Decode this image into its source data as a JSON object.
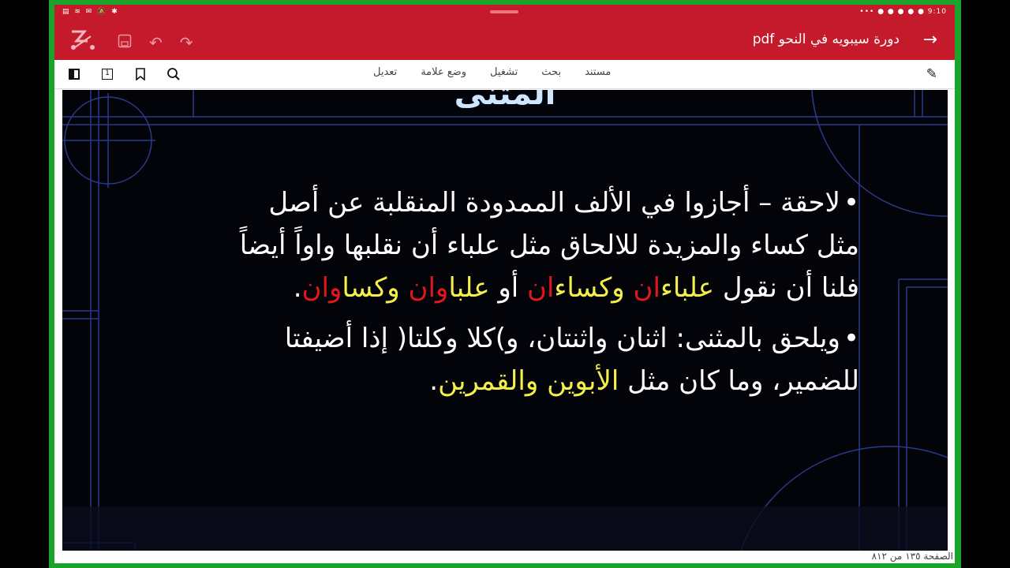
{
  "status": {
    "left": "▤ ≋ ✉ 🔕 ✱",
    "right": "••• ● ● ● ● ● 9:10"
  },
  "appbar": {
    "title": "دورة سيبويه في النحو pdf"
  },
  "toolbar": {
    "menu": [
      "مستند",
      "بحث",
      "تشغيل",
      "وضع علامة",
      "تعديل"
    ],
    "page_icon": "1"
  },
  "icons": {
    "back": "arrow-right-icon",
    "logo": "app-logo-icon",
    "save": "save-icon",
    "undo": "undo-icon",
    "redo": "redo-icon",
    "pen": "pen-icon",
    "sidebar": "sidebar-toggle-icon",
    "page": "page-number-icon",
    "bookmark": "bookmark-icon",
    "search": "search-icon"
  },
  "slide": {
    "heading": "المثنى",
    "p1": {
      "bullet": "•",
      "line1": "لاحقة – أجازوا في الألف الممدودة المنقلبة عن أصل",
      "line2": "مثل كساء والمزيدة للالحاق مثل علباء أن نقلبها واواً أيضاً",
      "line3_prefix": "فلنا أن نقول ",
      "s1y": "علباء",
      "s1r": "ان",
      "s2y": " وكساء",
      "s2r": "ان",
      "mid": " أو ",
      "s3y": "علبا",
      "s3r": "وان",
      "s4y": " وكسا",
      "s4r": "وان",
      "end": "."
    },
    "p2": {
      "bullet": "•",
      "line1": "ويلحق بالمثنى: اثنان واثنتان، و)كلا وكلتا( إذا أضيفتا",
      "line2_prefix": "للضمير، وما كان مثل ",
      "highlight": "الأبوين والقمرين",
      "end": "."
    }
  },
  "footer": {
    "page_label": "الصفحة ١٣٥ من ٨١٢"
  }
}
